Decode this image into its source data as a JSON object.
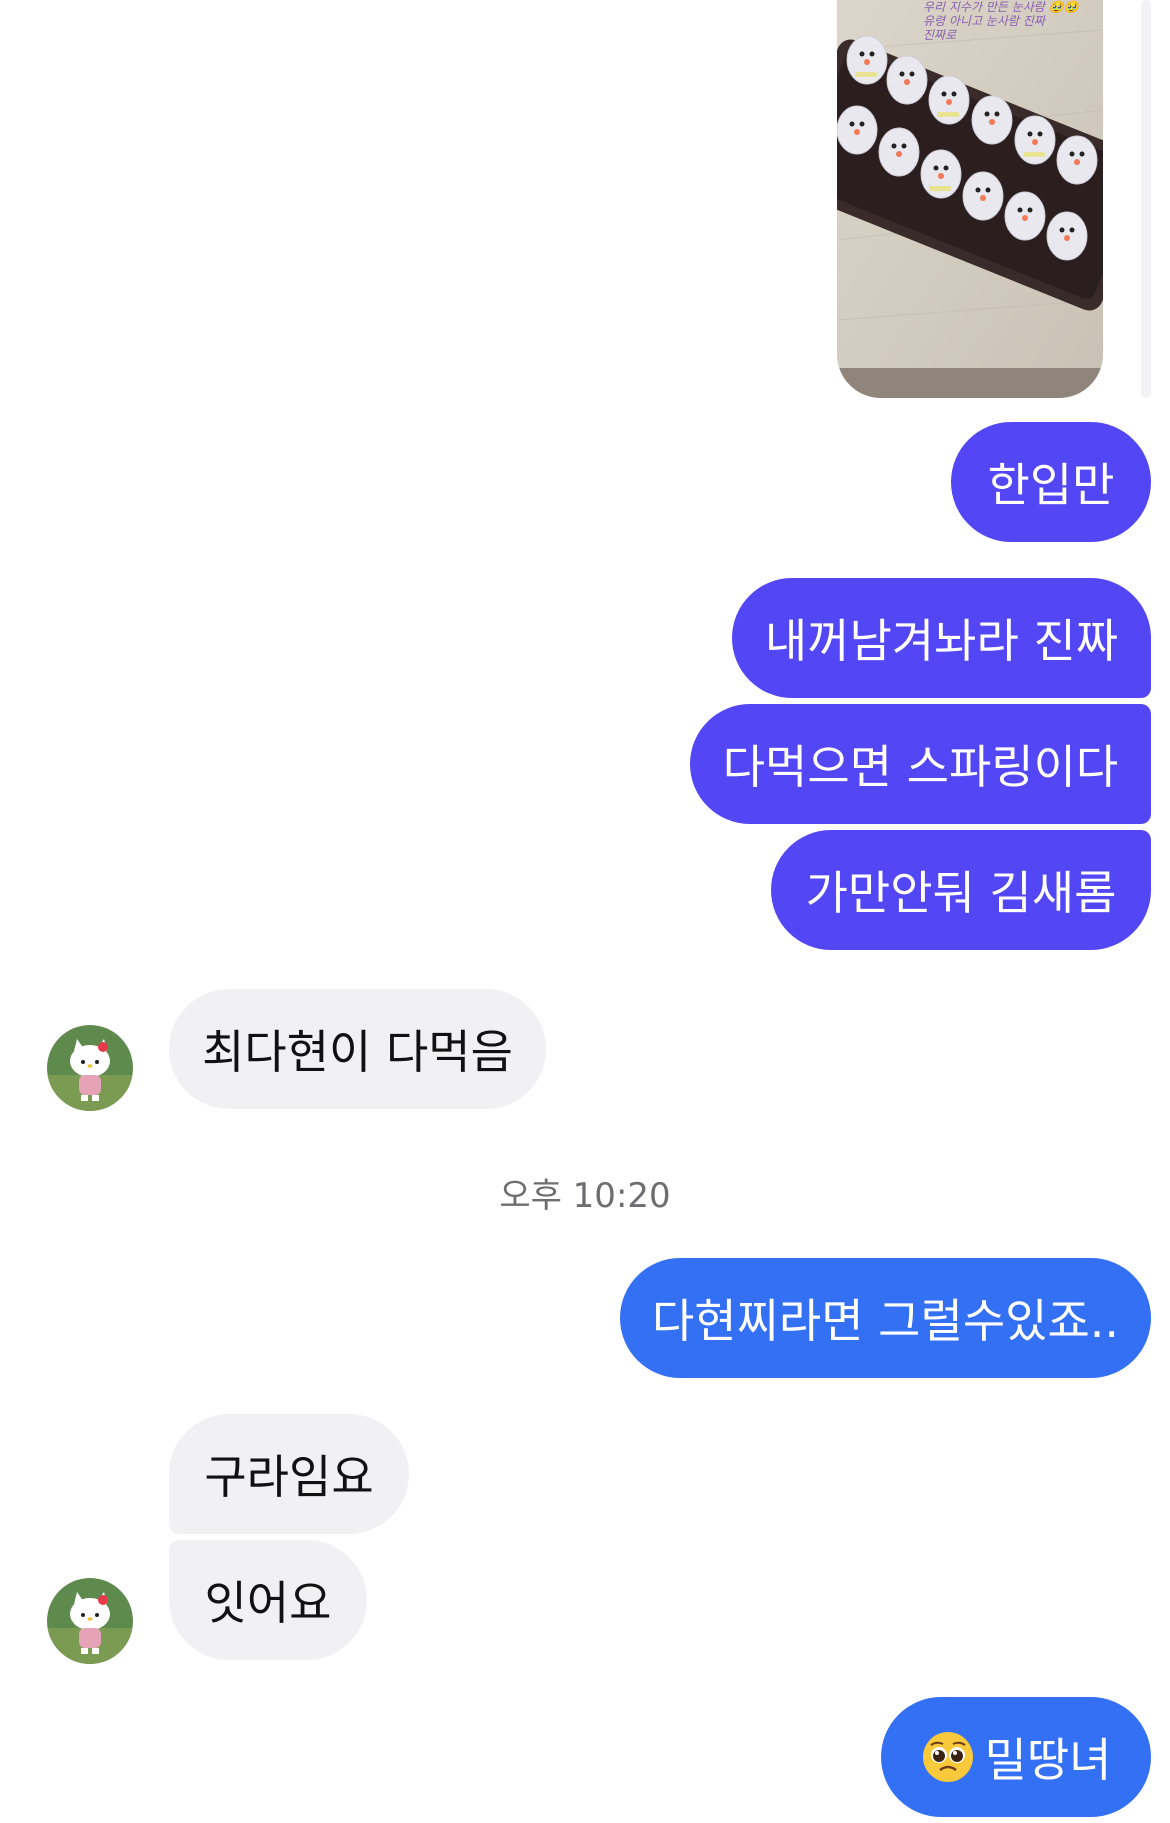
{
  "chat": {
    "photo_message": {
      "caption": "우리 지수가 만든 눈사람 🥹🥹\n유령 아니고 눈사람 진짜\n진짜로"
    },
    "messages": [
      {
        "id": "m1",
        "text": "한입만",
        "sender": "me"
      },
      {
        "id": "m2",
        "text": "내꺼남겨놔라 진짜",
        "sender": "me"
      },
      {
        "id": "m3",
        "text": "다먹으면 스파링이다",
        "sender": "me"
      },
      {
        "id": "m4",
        "text": "가만안둬 김새롬",
        "sender": "me"
      },
      {
        "id": "m5",
        "text": "최다현이 다먹음",
        "sender": "other"
      },
      {
        "id": "m6",
        "text": "다현찌라면 그럴수있죠..",
        "sender": "me"
      },
      {
        "id": "m7",
        "text": "구라임요",
        "sender": "other"
      },
      {
        "id": "m8",
        "text": "잇어요",
        "sender": "other"
      },
      {
        "id": "m9",
        "text": "밀땅녀",
        "sender": "me",
        "emoji": "pleading-face"
      }
    ],
    "timestamp": "오후 10:20"
  },
  "colors": {
    "outgoing_purple": "#5346f5",
    "outgoing_blue": "#3470f4",
    "incoming_bg": "#f1f1f3",
    "timestamp_text": "#6d6d72"
  },
  "icons": {
    "avatar": "hello-kitty-avatar",
    "reaction_emoji": "pleading-face-emoji"
  }
}
